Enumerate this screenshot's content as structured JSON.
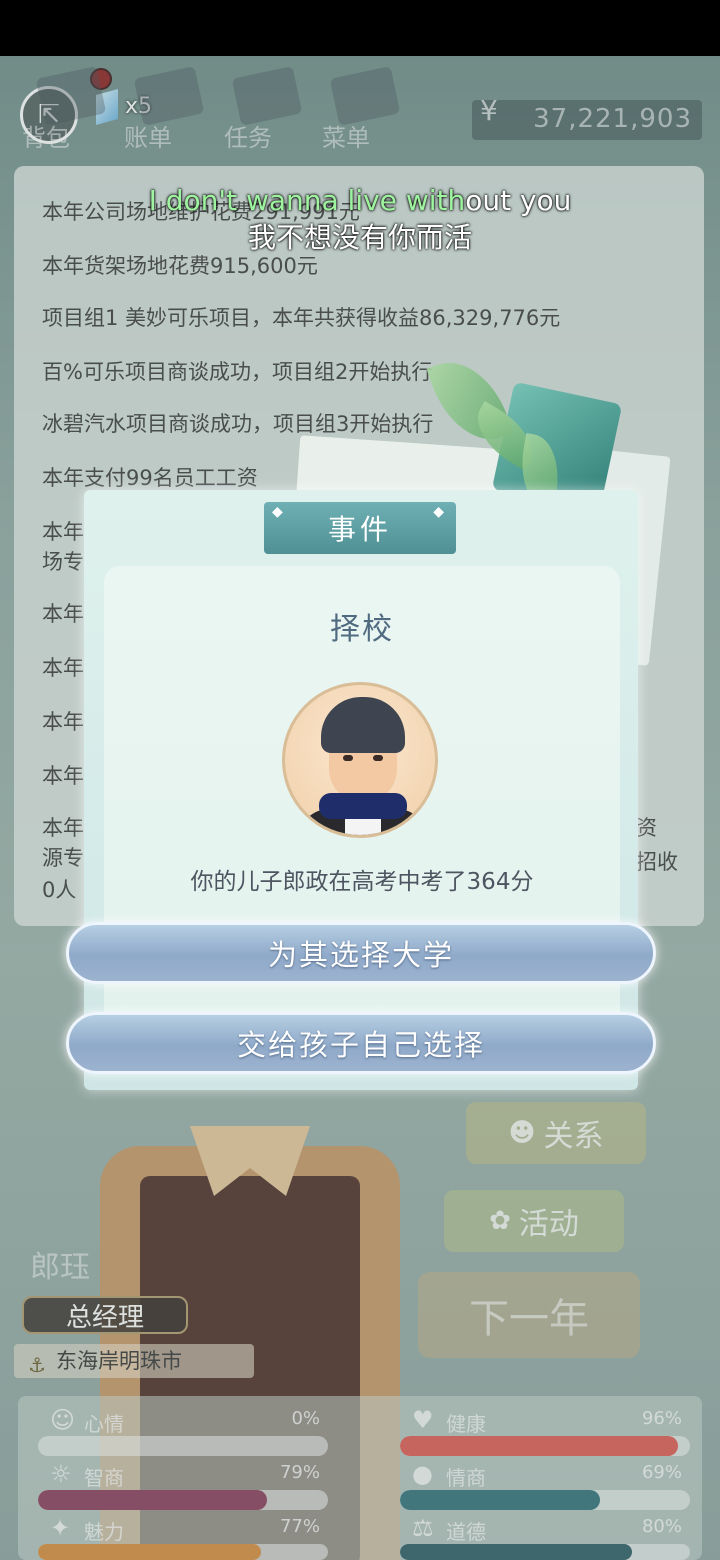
{
  "nav": {
    "gem_count": "x5",
    "items": [
      {
        "label": "背包"
      },
      {
        "label": "账单"
      },
      {
        "label": "任务"
      },
      {
        "label": "菜单"
      }
    ],
    "money_icon": "¥",
    "money": "37,221,903"
  },
  "subtitle": {
    "en_highlight": "I don't wanna live with",
    "en_rest": "out you",
    "zh": "我不想没有你而活"
  },
  "log": {
    "lines": [
      "本年公司场地维护花费291,991元",
      "本年货架场地花费915,600元",
      "项目组1 美妙可乐项目，本年共获得收益86,329,776元",
      "百%可乐项目商谈成功，项目组2开始执行",
      "冰碧汽水项目商谈成功，项目组3开始执行",
      "本年支付99名员工工资",
      "本年共",
      "场专",
      "本年",
      "本年",
      "本年",
      "本年",
      "本年",
      "源专",
      "0人"
    ],
    "right_fragments": [
      "资",
      "招收"
    ]
  },
  "side_buttons": {
    "relations": "关系",
    "activity": "活动",
    "next_year": "下一年"
  },
  "character": {
    "name": "郎珏",
    "title": "总经理",
    "city": "东海岸明珠市"
  },
  "stats": [
    {
      "icon": "☺",
      "label": "心情",
      "value": "0%",
      "fraction": 0.0,
      "color": "#e36a5a"
    },
    {
      "icon": "♥",
      "label": "健康",
      "value": "96%",
      "fraction": 0.96,
      "color": "#e0584f"
    },
    {
      "icon": "☼",
      "label": "智商",
      "value": "79%",
      "fraction": 0.79,
      "color": "#8a3a5a"
    },
    {
      "icon": "●",
      "label": "情商",
      "value": "69%",
      "fraction": 0.69,
      "color": "#2e6f78"
    },
    {
      "icon": "✦",
      "label": "魅力",
      "value": "77%",
      "fraction": 0.77,
      "color": "#d98b3a"
    },
    {
      "icon": "⚖",
      "label": "道德",
      "value": "80%",
      "fraction": 0.8,
      "color": "#2b5a64"
    }
  ],
  "modal": {
    "header": "事件",
    "title": "择校",
    "description": "你的儿子郎政在高考中考了364分",
    "choices": [
      {
        "label": "为其选择大学"
      },
      {
        "label": "交给孩子自己选择"
      }
    ]
  },
  "colors": {
    "modal_header": "#5fa2a6",
    "choice_button": "#9cb3cf",
    "subtitle_highlight": "#9ff59f"
  }
}
